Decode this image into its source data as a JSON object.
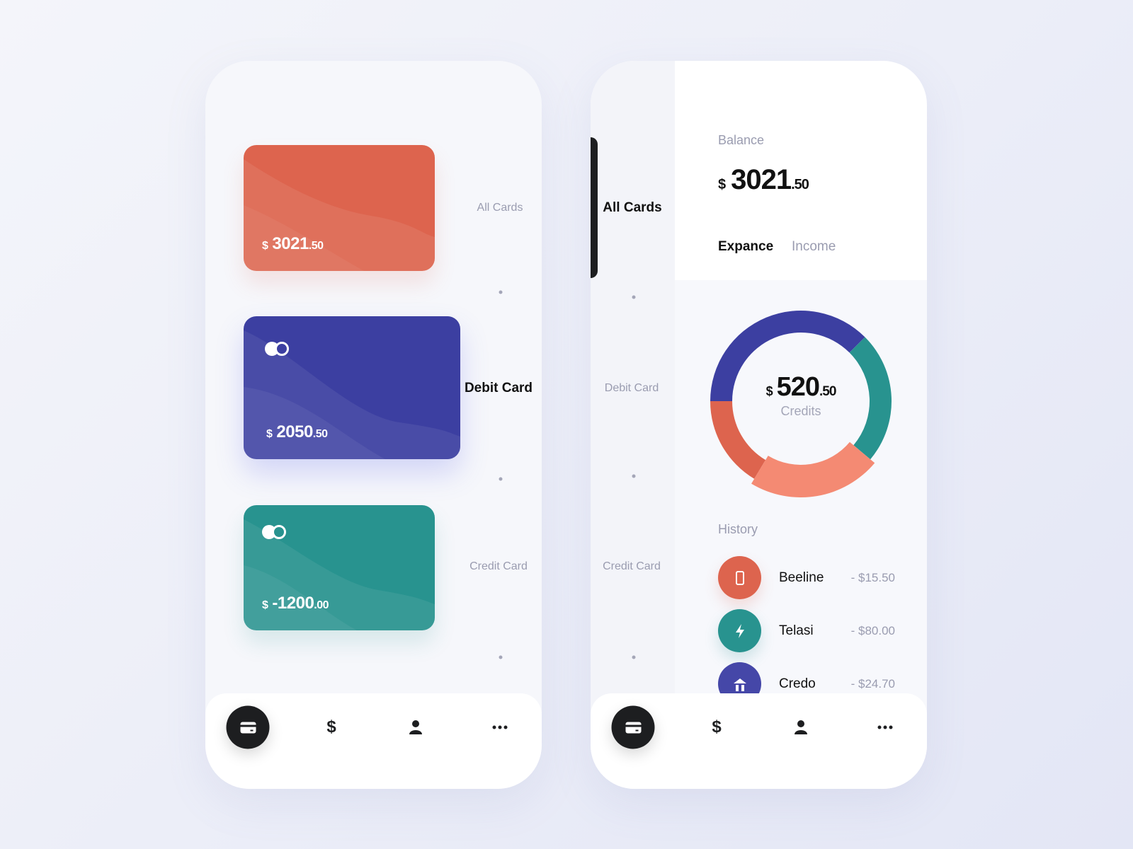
{
  "colors": {
    "red": "#dd644e",
    "blue": "#3c3fa1",
    "teal": "#28938f",
    "salmon": "#f48a73",
    "dark": "#1d1e20",
    "muted": "#9a9cb0"
  },
  "left_screen": {
    "cards": [
      {
        "type": "red",
        "currency": "$",
        "whole": "3021",
        "decimal": ".50"
      },
      {
        "type": "debit",
        "currency": "$",
        "whole": "2050",
        "decimal": ".50"
      },
      {
        "type": "credit",
        "currency": "$",
        "whole": "-1200",
        "decimal": ".00"
      }
    ],
    "labels": [
      "All Cards",
      "Debit Card",
      "Credit Card"
    ],
    "active_label": "Debit Card"
  },
  "right_screen": {
    "sidebar": [
      "All Cards",
      "Debit Card",
      "Credit Card"
    ],
    "active_sidebar": "All Cards",
    "balance_label": "Balance",
    "balance": {
      "currency": "$",
      "whole": "3021",
      "decimal": ".50"
    },
    "tabs": [
      {
        "label": "Expance",
        "active": true
      },
      {
        "label": "Income",
        "active": false
      }
    ],
    "donut": {
      "currency": "$",
      "whole": "520",
      "decimal": ".50",
      "label": "Credits",
      "segments": [
        {
          "color": "#3c3fa1",
          "share": 0.375
        },
        {
          "color": "#28938f",
          "share": 0.236
        },
        {
          "color": "#f48a73",
          "share": 0.225,
          "highlighted": true
        },
        {
          "color": "#dd644e",
          "share": 0.164
        }
      ]
    },
    "history_label": "History",
    "history": [
      {
        "name": "Beeline",
        "amount": "- $15.50",
        "icon": "phone-icon",
        "color": "#dd644e"
      },
      {
        "name": "Telasi",
        "amount": "- $80.00",
        "icon": "lightning-icon",
        "color": "#28938f"
      },
      {
        "name": "Credo",
        "amount": "- $24.70",
        "icon": "bank-icon",
        "color": "#4547a8"
      }
    ]
  },
  "nav": [
    "card-icon",
    "dollar-icon",
    "user-icon",
    "more-icon"
  ]
}
